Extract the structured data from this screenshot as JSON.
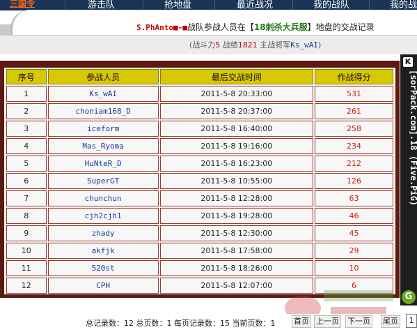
{
  "nav": {
    "logo": "三国令",
    "items": [
      "游击队",
      "抢地盘",
      "最近战况",
      "我的战队",
      "我的战"
    ]
  },
  "header": {
    "clan_name": "S.PhAnto■-■",
    "title_mid": "战队参战人员在【",
    "server": "18刺杀大兵服",
    "title_end": "】地盘的交战记录"
  },
  "summary": {
    "prefix": "(战斗力",
    "power": "5",
    "mid1": " 战绩",
    "record": "1821",
    "mid2": " 主战将军",
    "commander": "Ks_wAI",
    "suffix": ")"
  },
  "table": {
    "headers": [
      "序号",
      "参战人员",
      "最后交战时间",
      "作战得分"
    ],
    "rows": [
      {
        "idx": "1",
        "name": "Ks_wAI",
        "time": "2011-5-8 20:33:00",
        "score": "531"
      },
      {
        "idx": "2",
        "name": "choniam168_D",
        "time": "2011-5-8 20:37:00",
        "score": "261"
      },
      {
        "idx": "3",
        "name": "iceform",
        "time": "2011-5-8 16:40:00",
        "score": "258"
      },
      {
        "idx": "4",
        "name": "Mas_Ryoma",
        "time": "2011-5-8 19:16:00",
        "score": "234"
      },
      {
        "idx": "5",
        "name": "HuNteR_D",
        "time": "2011-5-8 16:23:00",
        "score": "212"
      },
      {
        "idx": "6",
        "name": "SuperGT",
        "time": "2011-5-8 10:55:00",
        "score": "126"
      },
      {
        "idx": "7",
        "name": "chunchun",
        "time": "2011-5-8 12:28:00",
        "score": "63"
      },
      {
        "idx": "8",
        "name": "cjh2cjh1",
        "time": "2011-5-8 19:28:00",
        "score": "46"
      },
      {
        "idx": "9",
        "name": "zhady",
        "time": "2011-5-8 12:30:00",
        "score": "45"
      },
      {
        "idx": "10",
        "name": "akfjk",
        "time": "2011-5-8 17:58:00",
        "score": "29"
      },
      {
        "idx": "11",
        "name": "520st",
        "time": "2011-5-8 18:26:00",
        "score": "10"
      },
      {
        "idx": "12",
        "name": "CPH",
        "time": "2011-5-8 12:07:00",
        "score": "6"
      }
    ]
  },
  "banner": {
    "pin": "K",
    "text": "[sorPack.com].18 (Five.PiG)",
    "g_button": "G"
  },
  "pager": {
    "total_records_label": "总记录数：",
    "total_records": "12",
    "total_pages_label": " 总页数：",
    "total_pages": "1",
    "per_page_label": " 每页记录数：",
    "per_page": "15",
    "current_label": " 当前页数：",
    "current_page": "1",
    "first": "首页",
    "prev": "上一页",
    "next": "下一页",
    "last": "尾页",
    "goto_value": "1"
  },
  "colors": {
    "nav_bg": "#1b3557",
    "panel_border": "#5c1a10",
    "header_cell": "#d8c800",
    "score_red": "#cc1a10",
    "name_blue": "#1a3a9a"
  }
}
